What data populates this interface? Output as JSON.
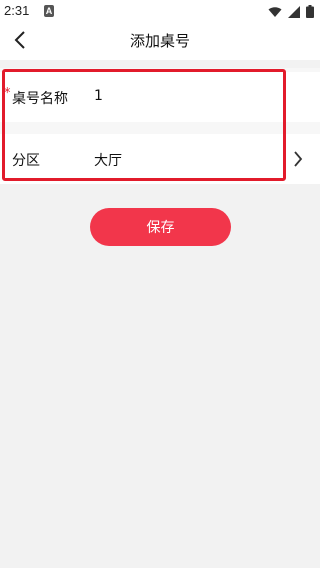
{
  "status_bar": {
    "time": "2:31",
    "icons": [
      "wifi-icon",
      "signal-icon",
      "battery-icon"
    ]
  },
  "header": {
    "title": "添加桌号",
    "back_icon": "chevron-left-icon"
  },
  "form": {
    "name_field": {
      "required_mark": "*",
      "label": "桌号名称",
      "value": "1"
    },
    "zone_field": {
      "label": "分区",
      "value": "大厅",
      "chevron_icon": "chevron-right-icon"
    }
  },
  "actions": {
    "save_label": "保存"
  },
  "colors": {
    "accent": "#f2364b",
    "highlight": "#e21b2b",
    "background": "#f2f2f2"
  }
}
